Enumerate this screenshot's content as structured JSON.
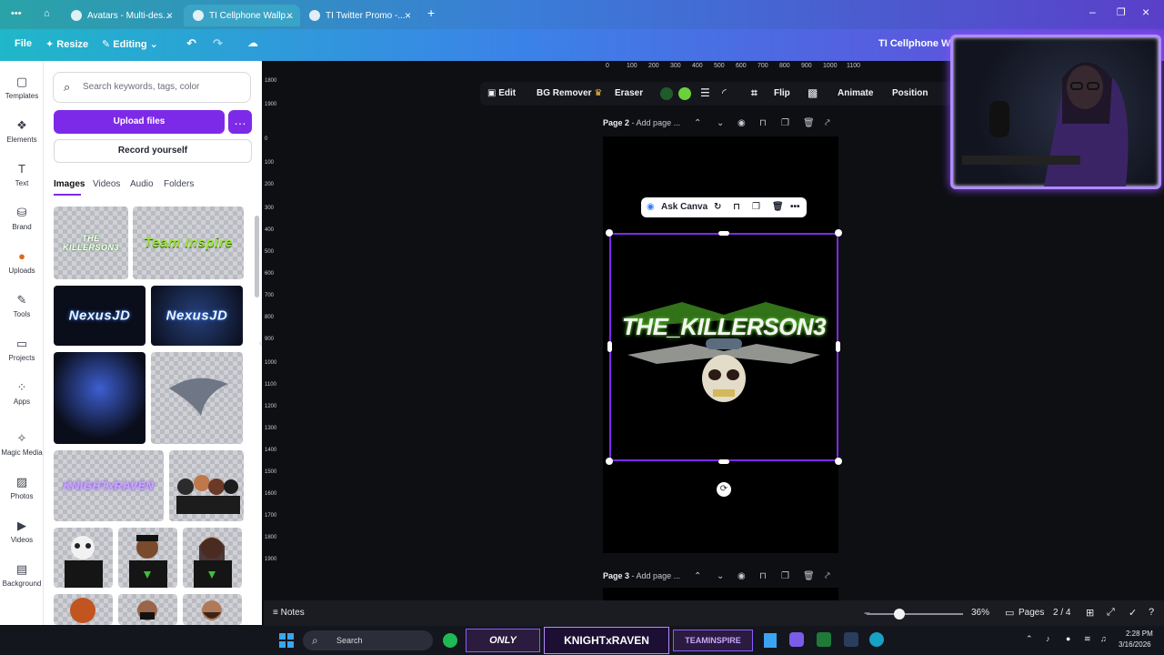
{
  "browser": {
    "tabs": [
      {
        "title": "Avatars - Multi-des..."
      },
      {
        "title": "TI Cellphone Wallp..."
      },
      {
        "title": "TI Twitter Promo -..."
      }
    ]
  },
  "toolbar": {
    "file": "File",
    "resize": "Resize",
    "editing": "Editing",
    "doc_title": "TI Cellphone Wall"
  },
  "rail": {
    "items": [
      "Templates",
      "Elements",
      "Text",
      "Brand",
      "Uploads",
      "Tools",
      "Projects",
      "Apps",
      "Magic Media",
      "Photos",
      "Videos",
      "Background"
    ]
  },
  "panel": {
    "search_placeholder": "Search keywords, tags, color",
    "upload_label": "Upload files",
    "record_label": "Record yourself",
    "tabs": [
      "Images",
      "Videos",
      "Audio",
      "Folders"
    ],
    "thumbs": [
      "THE KILLERSON3",
      "Team Inspire",
      "NexusJD",
      "NexusJD",
      "KNIGHTxRAVEN"
    ]
  },
  "ruler": {
    "top": [
      "0",
      "100",
      "200",
      "300",
      "400",
      "500",
      "600",
      "700",
      "800",
      "900",
      "1000",
      "1100"
    ],
    "left": [
      "1800",
      "1900",
      "0",
      "100",
      "200",
      "300",
      "400",
      "500",
      "600",
      "700",
      "800",
      "900",
      "1000",
      "1100",
      "1200",
      "1300",
      "1400",
      "1500",
      "1600",
      "1700",
      "1800",
      "1900"
    ]
  },
  "context_toolbar": {
    "edit": "Edit",
    "bg_remover": "BG Remover",
    "eraser": "Eraser",
    "flip": "Flip",
    "animate": "Animate",
    "position": "Position"
  },
  "pages": {
    "page2_label": "Page 2",
    "page3_label": "Page 3",
    "add_title": "- Add page ..."
  },
  "selection": {
    "ask_canva": "Ask Canva",
    "logo_text": "THE_KILLERSON3"
  },
  "bottom": {
    "notes": "Notes",
    "zoom": "36%",
    "zoom_fraction": 0.36,
    "pages": "Pages",
    "page_count": "2 / 4"
  },
  "taskbar": {
    "search": "Search",
    "brand_only": "ONLY",
    "brand_knight": "KNIGHTxRAVEN",
    "brand_team": "TEAMINSPIRE",
    "time": "2:28 PM",
    "date": "3/16/2026"
  },
  "colors": {
    "accent": "#7d2ae8",
    "green": "#6bd13a"
  }
}
